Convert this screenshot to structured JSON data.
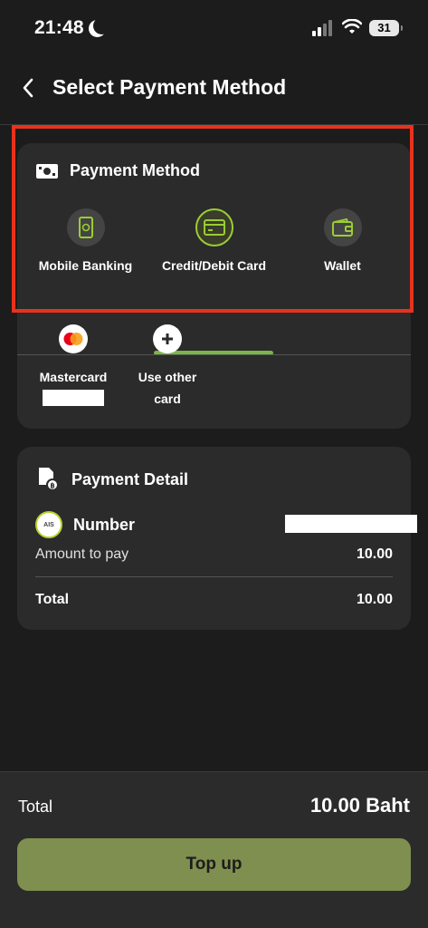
{
  "status_bar": {
    "time": "21:48",
    "battery": "31"
  },
  "header": {
    "title": "Select Payment Method"
  },
  "payment_method": {
    "title": "Payment Method",
    "tabs": [
      {
        "label": "Mobile Banking",
        "icon": "mobile-banking-icon"
      },
      {
        "label": "Credit/Debit Card",
        "icon": "credit-card-icon",
        "active": true
      },
      {
        "label": "Wallet",
        "icon": "wallet-icon"
      }
    ],
    "card_options": [
      {
        "label": "Mastercard",
        "icon": "mastercard-icon"
      },
      {
        "label": "Use other card",
        "icon": "plus-icon"
      }
    ]
  },
  "payment_detail": {
    "title": "Payment Detail",
    "number_label": "Number",
    "logo_text": "AIS",
    "amount_label": "Amount to pay",
    "amount_value": "10.00",
    "total_label": "Total",
    "total_value": "10.00"
  },
  "footer": {
    "total_label": "Total",
    "total_value": "10.00 Baht",
    "topup_label": "Top up"
  },
  "colors": {
    "accent": "#9acd32",
    "button": "#7f8f4f",
    "highlight_frame": "#e8321c"
  }
}
